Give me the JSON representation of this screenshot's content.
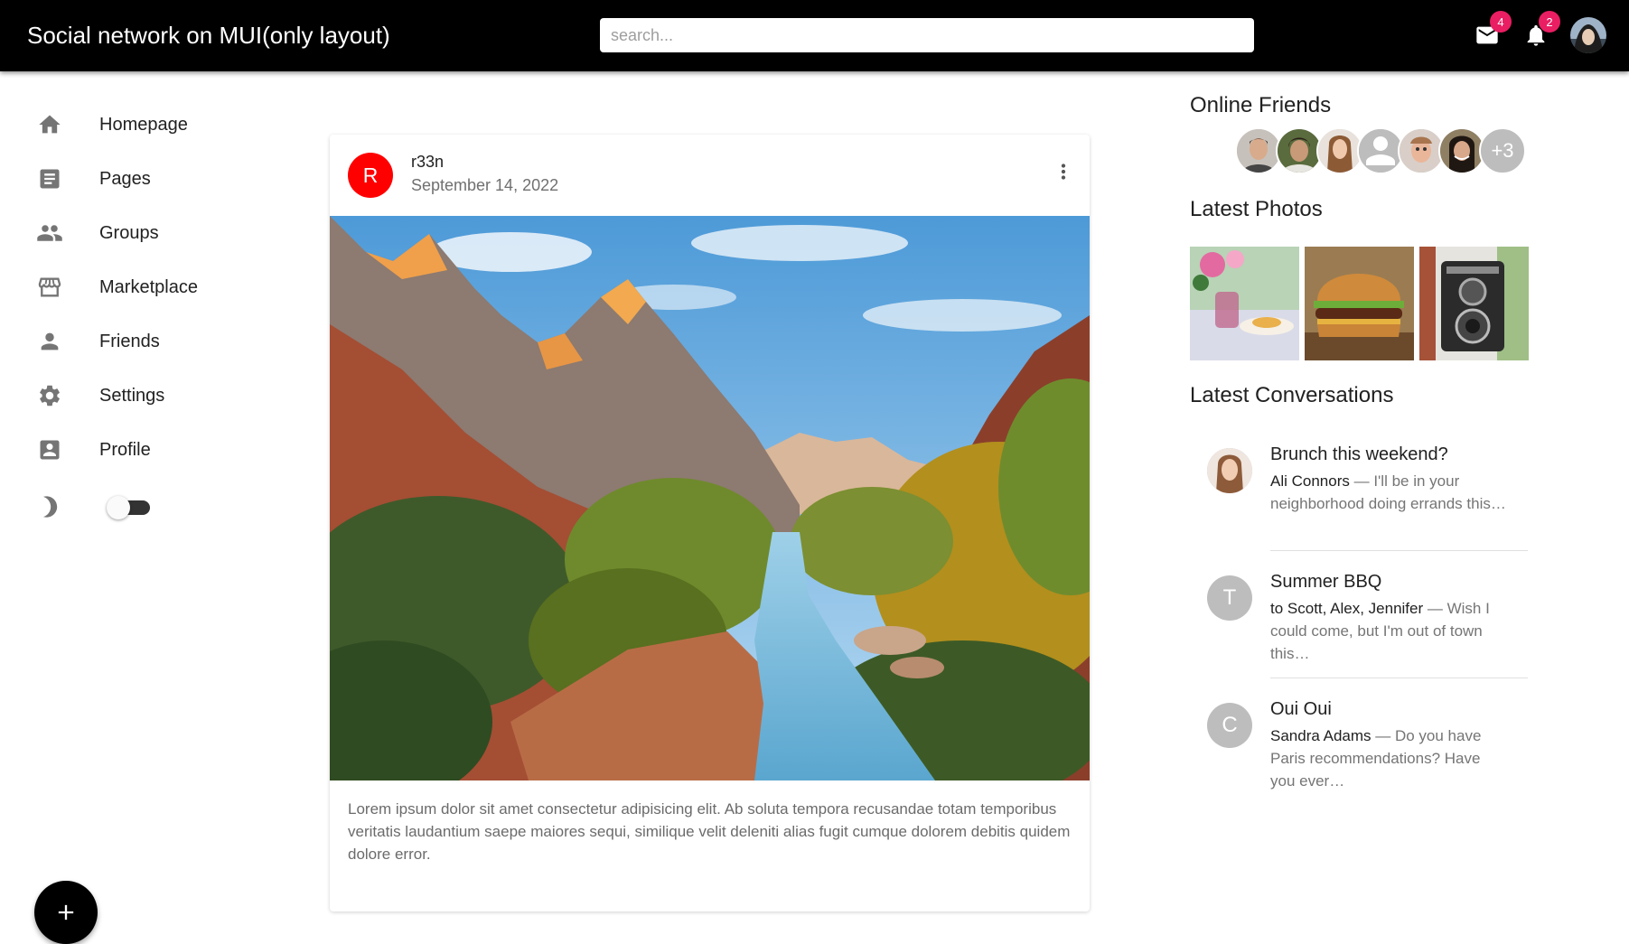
{
  "header": {
    "title": "Social network on MUI(only layout)",
    "search_placeholder": "search...",
    "mail_badge": "4",
    "notifications_badge": "2",
    "mail_icon": "mail-icon",
    "notifications_icon": "bell-icon"
  },
  "sidebar": {
    "items": [
      {
        "label": "Homepage",
        "icon": "home-icon"
      },
      {
        "label": "Pages",
        "icon": "article-icon"
      },
      {
        "label": "Groups",
        "icon": "group-icon"
      },
      {
        "label": "Marketplace",
        "icon": "storefront-icon"
      },
      {
        "label": "Friends",
        "icon": "person-icon"
      },
      {
        "label": "Settings",
        "icon": "gear-icon"
      },
      {
        "label": "Profile",
        "icon": "account-box-icon"
      }
    ],
    "dark_mode_icon": "moon-icon",
    "dark_mode_enabled": false,
    "fab_icon": "plus-icon"
  },
  "post": {
    "avatar_letter": "R",
    "avatar_color": "#ff0000",
    "author": "r33n",
    "date": "September 14, 2022",
    "menu_icon": "more-vert-icon",
    "image": "mountain-canyon-river-photo",
    "text": "Lorem ipsum dolor sit amet consectetur adipisicing elit. Ab soluta tempora recusandae totam temporibus veritatis laudantium saepe maiores sequi, similique velit deleniti alias fugit cumque dolorem debitis quidem dolore error."
  },
  "right": {
    "online_friends_title": "Online Friends",
    "online_friends_more": "+3",
    "latest_photos_title": "Latest Photos",
    "photos": [
      "dessert-table-photo",
      "burger-photo",
      "vintage-camera-photo"
    ],
    "latest_conversations_title": "Latest Conversations",
    "conversations": [
      {
        "title": "Brunch this weekend?",
        "who": "Ali Connors",
        "snippet": " — I'll be in your neighborhood doing errands this…",
        "avatar": ""
      },
      {
        "title": "Summer BBQ",
        "who": "to Scott, Alex, Jennifer",
        "snippet": " — Wish I could come, but I'm out of town this…",
        "avatar": "T"
      },
      {
        "title": "Oui Oui",
        "who": "Sandra Adams",
        "snippet": " — Do you have Paris recommendations? Have you ever…",
        "avatar": "C"
      }
    ]
  },
  "colors": {
    "appbar": "#000000",
    "badge": "#e91e63",
    "post_avatar": "#ff0000",
    "fab": "#000000"
  }
}
